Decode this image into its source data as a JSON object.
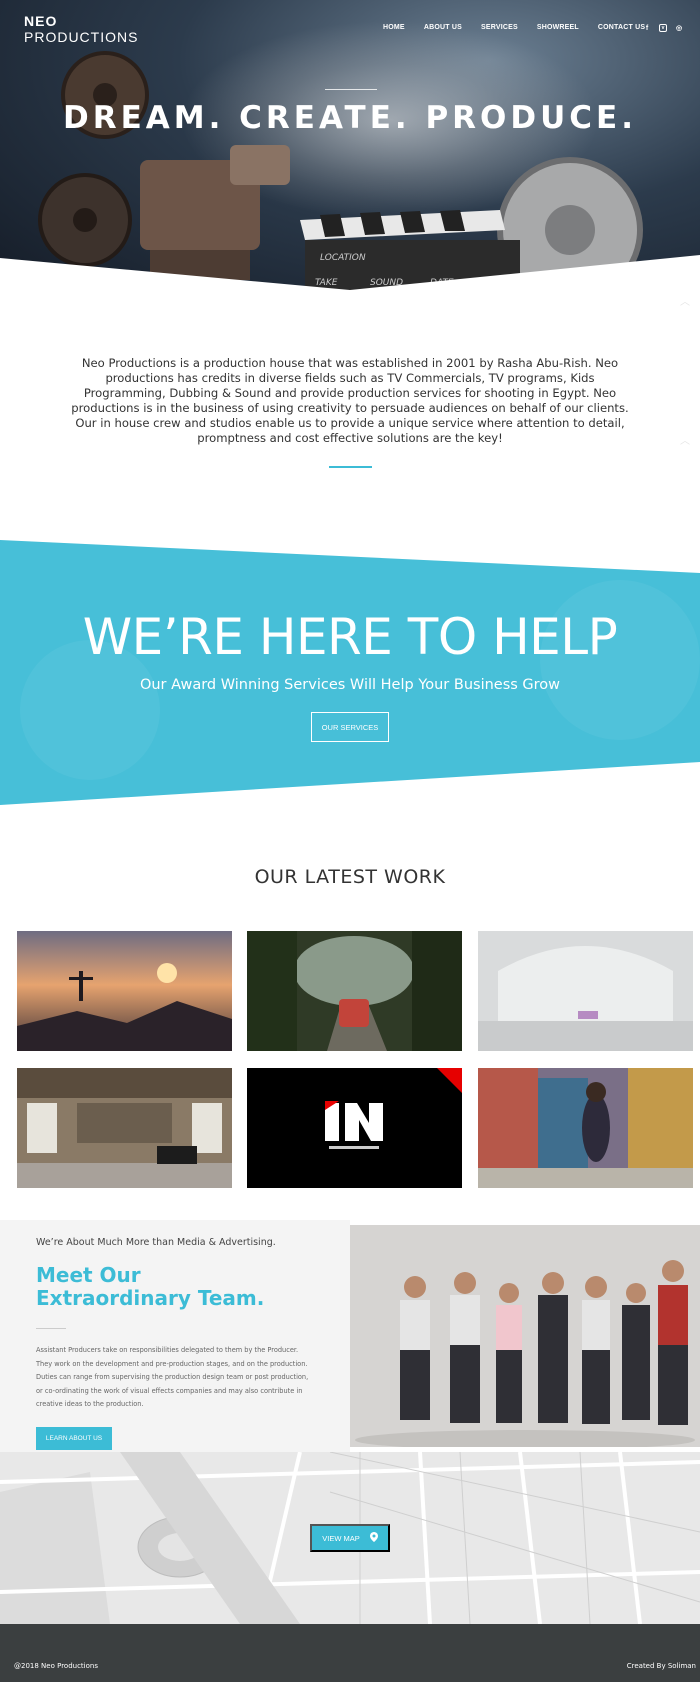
{
  "brand": {
    "line1": "NEO",
    "line2": "PRODUCTIONS"
  },
  "nav": {
    "items": [
      {
        "label": "HOME"
      },
      {
        "label": "ABOUT US"
      },
      {
        "label": "SERVICES"
      },
      {
        "label": "SHOWREEL"
      },
      {
        "label": "CONTACT US"
      }
    ],
    "social": [
      {
        "icon": "facebook-icon",
        "glyph": "f"
      },
      {
        "icon": "vimeo-icon",
        "glyph": "v"
      },
      {
        "icon": "instagram-icon",
        "glyph": "◎"
      }
    ]
  },
  "hero": {
    "title": "DREAM. CREATE. PRODUCE.",
    "clapper_words": [
      "LOCATION",
      "TAKE",
      "SOUND",
      "DATE"
    ]
  },
  "intro": {
    "text": "Neo Productions is a production house that was established in 2001 by Rasha Abu-Rish. Neo productions has credits in diverse fields such as TV Commercials, TV programs, Kids Programming, Dubbing & Sound and provide production services for shooting in Egypt. Neo productions is in the business of using creativity to persuade audiences on behalf of our clients. Our in house crew and studios enable us to provide a unique service where attention to detail, promptness and cost effective solutions are the key!"
  },
  "help": {
    "title": "WE’RE HERE TO HELP",
    "subtitle": "Our Award Winning Services Will Help Your Business Grow",
    "button": "OUR SERVICES"
  },
  "work": {
    "title": "OUR LATEST WORK"
  },
  "team": {
    "eyebrow": "We’re About Much More than Media & Advertising.",
    "title": "Meet Our Extraordinary Team.",
    "body": "Assistant Producers take on responsibilities delegated to them by the Producer. They work on the development and pre-production stages, and on the production. Duties can range from supervising the production design team or post production, or co-ordinating the work of visual effects companies and may also contribute in creative ideas to the production.",
    "button": "LEARN ABOUT US"
  },
  "map": {
    "button": "VIEW MAP"
  },
  "footer": {
    "copyright": "@2018 Neo Productions",
    "credit": "Created By Soliman"
  },
  "colors": {
    "accent": "#3cbcd6",
    "footer": "#3b3f40"
  }
}
